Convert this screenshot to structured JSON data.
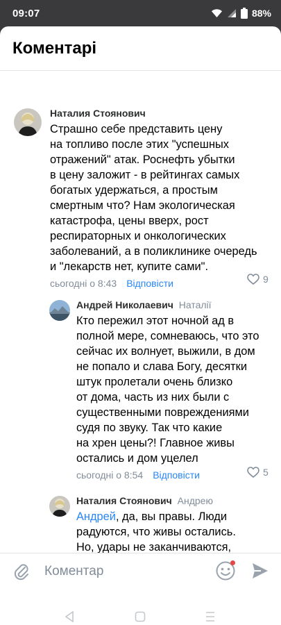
{
  "status_bar": {
    "time": "09:07",
    "battery": "88%",
    "icons": [
      "wifi-icon",
      "signal-icon",
      "battery-icon"
    ]
  },
  "sheet": {
    "title": "Коментарі"
  },
  "comments": [
    {
      "author": "Наталия Стоянович",
      "reply_to": "",
      "text": "Страшно себе представить цену\nна топливо после этих \"успешных\nотражений\" атак. Роснефть убытки\nв цену заложит - в рейтингах самых\nбогатых удержаться, а простым\nсмертным что? Нам экологическая\nкатастрофа, цены вверх, рост\nреспираторных и онкологических\nзаболеваний, а в поликлинике очередь\nи \"лекарств нет, купите сами\".",
      "time": "сьогодні о 8:43",
      "reply_label": "Відповісти",
      "likes": "9"
    },
    {
      "author": "Андрей Николаевич",
      "reply_to": "Наталії",
      "text": "Кто пережил этот ночной ад в\nполной мере, сомневаюсь, что это\nсейчас их волнует, выжили, в дом\nне попало и слава Богу, десятки\nштук пролетали очень близко\nот дома, часть из них  были с\nсущественными повреждениями\nсудя по звуку. Так что какие\nна хрен цены?! Главное живы\nостались и дом уцелел",
      "time": "сьогодні о 8:54",
      "reply_label": "Відповісти",
      "likes": "5"
    },
    {
      "author": "Наталия Стоянович",
      "reply_to": "Андрею",
      "mention": "Андрей",
      "text_after_mention": ", да, вы правы. Люди\nрадуются, что живы остались.\nНо, удары не заканчиваются,\nа последствия этой движухи\nбудем выгребать мы - своим"
    }
  ],
  "composer": {
    "placeholder": "Коментар",
    "icons": [
      "attach-icon",
      "emoji-icon",
      "send-icon"
    ],
    "notification_color": "#e64646"
  },
  "colors": {
    "accent": "#2787f5",
    "secondary_text": "#818c99",
    "status_bar_bg": "#3a3a3c"
  }
}
